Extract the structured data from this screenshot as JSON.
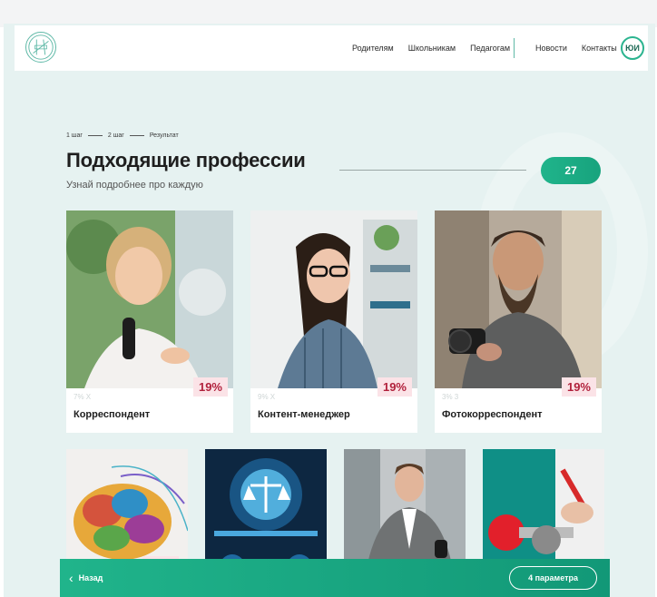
{
  "nav": {
    "left_items": [
      "Родителям",
      "Школьникам",
      "Педагогам"
    ],
    "right_items": [
      "Новости",
      "Контакты"
    ],
    "avatar_initials": "ЮИ"
  },
  "steps": [
    "1 шаг",
    "2 шаг",
    "Результат"
  ],
  "page": {
    "title": "Подходящие профессии",
    "subtitle": "Узнай подробнее про каждую",
    "count": "27"
  },
  "cards": [
    {
      "name": "Корреспондент",
      "match": "19%",
      "faint": "7% X"
    },
    {
      "name": "Контент-менеджер",
      "match": "19%",
      "faint": "9% X"
    },
    {
      "name": "Фотокорреспондент",
      "match": "19%",
      "faint": "3% 3"
    }
  ],
  "bottom": {
    "back_label": "Назад",
    "params_label": "4 параметра"
  },
  "colors": {
    "accent": "#20b48b",
    "background": "#e6f2f1",
    "badge_bg": "#fbe3e7",
    "badge_text": "#b1213c"
  }
}
